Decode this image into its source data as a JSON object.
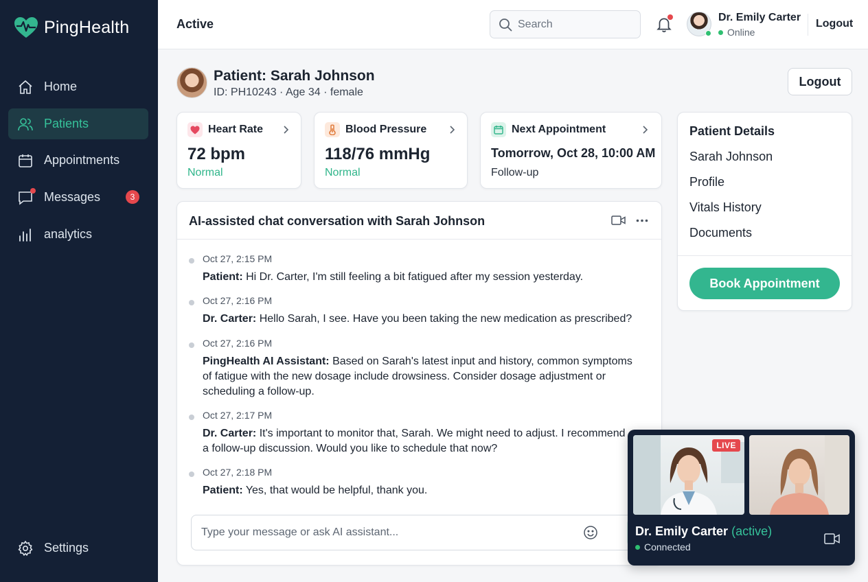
{
  "app": {
    "name": "PingHealth",
    "accent": "#33b68f",
    "sidebar_bg": "#142035"
  },
  "sidebar": {
    "items": [
      {
        "label": "Home",
        "icon": "home-icon"
      },
      {
        "label": "Patients",
        "icon": "users-icon",
        "active": true
      },
      {
        "label": "Appointments",
        "icon": "calendar-icon"
      },
      {
        "label": "Messages",
        "icon": "chat-icon",
        "badge": "3"
      },
      {
        "label": "analytics",
        "icon": "bar-chart-icon"
      }
    ],
    "settings_label": "Settings"
  },
  "header": {
    "title": "Active",
    "search_placeholder": "Search",
    "user_name": "Dr. Emily Carter",
    "user_status": "Online",
    "logout_label": "Logout"
  },
  "patient": {
    "name": "Patient: Sarah Johnson",
    "meta": "ID: PH10243 · Age 34 · female",
    "logout_label": "Logout"
  },
  "vitals": {
    "heart_rate": {
      "label": "Heart Rate",
      "value": "72 bpm",
      "status": "Normal"
    },
    "blood_pressure": {
      "label": "Blood Pressure",
      "value": "118/76 mmHg",
      "status": "Normal"
    },
    "appointment": {
      "label": "Next Appointment",
      "value": "Tomorrow, Oct 28, 10:00 AM",
      "sub": "Follow-up"
    }
  },
  "details": {
    "title": "Patient Details",
    "links": [
      "Sarah Johnson",
      "Profile",
      "Vitals History",
      "Documents"
    ],
    "book_label": "Book Appointment"
  },
  "chat": {
    "title": "AI-assisted chat conversation with Sarah Johnson",
    "messages": [
      {
        "time": "Oct 27, 2:15 PM",
        "sender": "Patient:",
        "text": "Hi Dr. Carter, I'm still feeling a bit fatigued after my session yesterday."
      },
      {
        "time": "Oct 27, 2:16 PM",
        "sender": "Dr. Carter:",
        "text": "Hello Sarah, I see. Have you been taking the new medication as prescribed?"
      },
      {
        "time": "Oct 27, 2:16 PM",
        "sender": "PingHealth AI Assistant:",
        "text": "Based on Sarah's latest input and history, common symptoms of fatigue with the new dosage include drowsiness. Consider dosage adjustment or scheduling a follow-up."
      },
      {
        "time": "Oct 27, 2:17 PM",
        "sender": "Dr. Carter:",
        "text": "It's important to monitor that, Sarah. We might need to adjust. I recommend a follow-up discussion. Would you like to schedule that now?"
      },
      {
        "time": "Oct 27, 2:18 PM",
        "sender": "Patient:",
        "text": "Yes, that would be helpful, thank you."
      }
    ],
    "input_placeholder": "Type your message or ask AI assistant..."
  },
  "video_call": {
    "live_label": "LIVE",
    "name": "Dr. Emily Carter",
    "tag": "(active)",
    "status": "Connected"
  }
}
